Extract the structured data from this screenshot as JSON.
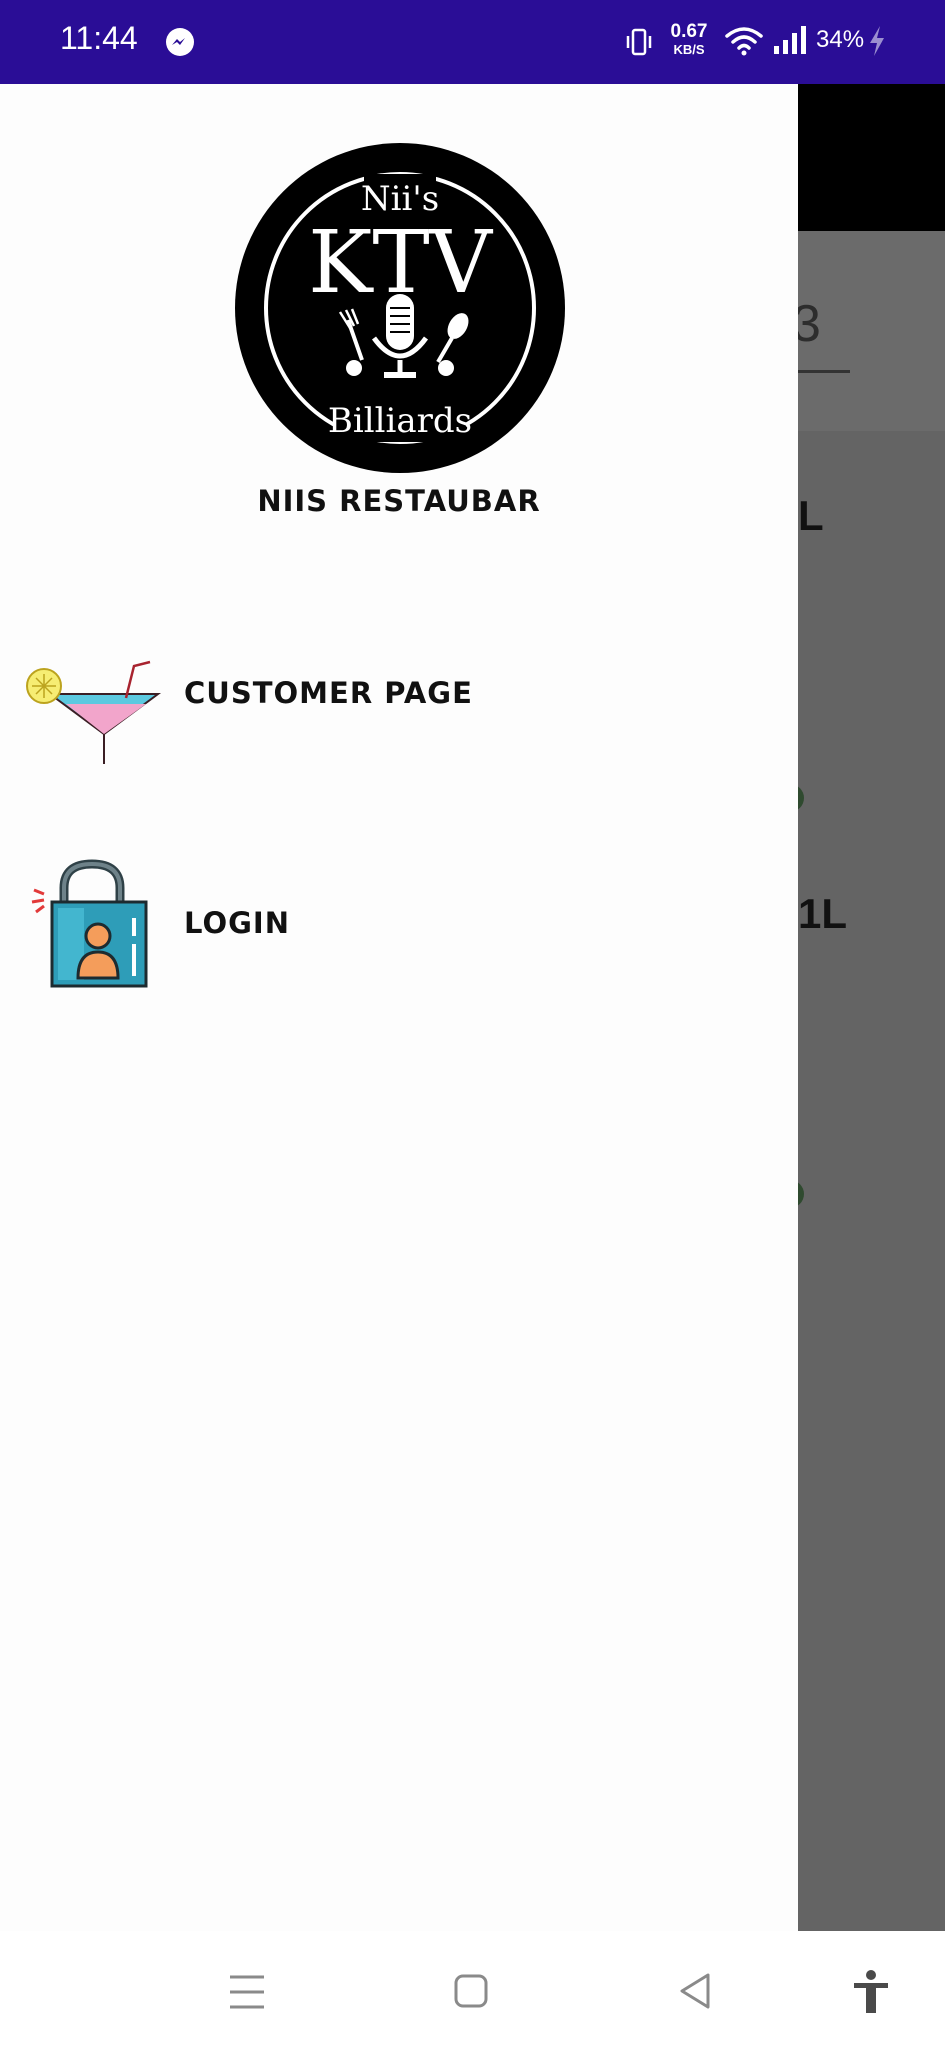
{
  "status_bar": {
    "time": "11:44",
    "net_speed_value": "0.67",
    "net_speed_unit": "KB/S",
    "battery": "34%",
    "icons": [
      "messenger-icon",
      "vibrate-icon",
      "wifi-icon",
      "signal-icon",
      "charging-icon"
    ],
    "background_color": "#2a0d96"
  },
  "background_app": {
    "input_text": "3",
    "label_1": "L",
    "label_2": "1L"
  },
  "drawer": {
    "logo": {
      "top_text": "Nii's",
      "main_text": "KTV",
      "bottom_text": "Billiards"
    },
    "title": "NIIS RESTAUBAR",
    "items": [
      {
        "label": "CUSTOMER PAGE",
        "icon": "cocktail-icon"
      },
      {
        "label": "LOGIN",
        "icon": "padlock-user-icon"
      }
    ]
  },
  "nav_bar": {
    "icons": [
      "recents-icon",
      "home-icon",
      "back-icon",
      "accessibility-icon"
    ]
  }
}
